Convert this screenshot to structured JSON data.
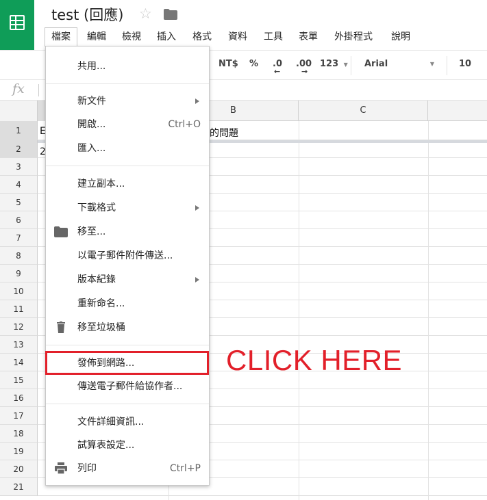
{
  "header": {
    "title": "test (回應)"
  },
  "menubar": [
    "檔案",
    "編輯",
    "檢視",
    "插入",
    "格式",
    "資料",
    "工具",
    "表單",
    "外掛程式",
    "說明"
  ],
  "toolbar": {
    "currency": "NT$",
    "percent": "%",
    "decimal_less": ".0",
    "decimal_more": ".00",
    "format_more": "123",
    "font": "Arial",
    "font_size": "10"
  },
  "formula": {
    "fx": "fx"
  },
  "columns": [
    "B",
    "C"
  ],
  "rows": [
    "1",
    "2",
    "3",
    "4",
    "5",
    "6",
    "7",
    "8",
    "9",
    "10",
    "11",
    "12",
    "13",
    "14",
    "15",
    "16",
    "17",
    "18",
    "19",
    "20",
    "21"
  ],
  "cells": {
    "a1_partial": "E",
    "a2_partial": "2",
    "b1": "的問題"
  },
  "file_menu": {
    "share": "共用...",
    "new": "新文件",
    "open": "開啟...",
    "open_shortcut": "Ctrl+O",
    "import": "匯入...",
    "make_copy": "建立副本...",
    "download_as": "下載格式",
    "move_to": "移至...",
    "email_attachment": "以電子郵件附件傳送...",
    "version_history": "版本紀錄",
    "rename": "重新命名...",
    "move_to_trash": "移至垃圾桶",
    "publish_to_web": "發佈到網路...",
    "email_collaborators": "傳送電子郵件給協作者...",
    "document_details": "文件詳細資訊...",
    "spreadsheet_settings": "試算表設定...",
    "print": "列印",
    "print_shortcut": "Ctrl+P"
  },
  "annotation": {
    "callout": "CLICK HERE"
  },
  "colors": {
    "brand": "#0f9d58",
    "highlight": "#e2202a"
  }
}
